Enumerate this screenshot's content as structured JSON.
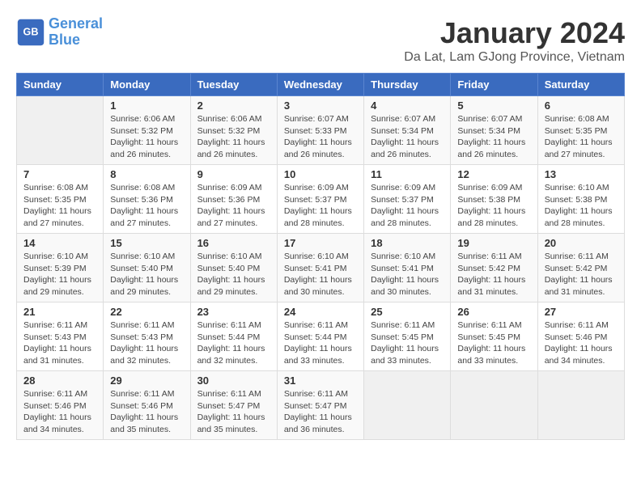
{
  "header": {
    "logo_line1": "General",
    "logo_line2": "Blue",
    "title": "January 2024",
    "subtitle": "Da Lat, Lam GJong Province, Vietnam"
  },
  "days_of_week": [
    "Sunday",
    "Monday",
    "Tuesday",
    "Wednesday",
    "Thursday",
    "Friday",
    "Saturday"
  ],
  "weeks": [
    [
      {
        "day": "",
        "info": ""
      },
      {
        "day": "1",
        "info": "Sunrise: 6:06 AM\nSunset: 5:32 PM\nDaylight: 11 hours\nand 26 minutes."
      },
      {
        "day": "2",
        "info": "Sunrise: 6:06 AM\nSunset: 5:32 PM\nDaylight: 11 hours\nand 26 minutes."
      },
      {
        "day": "3",
        "info": "Sunrise: 6:07 AM\nSunset: 5:33 PM\nDaylight: 11 hours\nand 26 minutes."
      },
      {
        "day": "4",
        "info": "Sunrise: 6:07 AM\nSunset: 5:34 PM\nDaylight: 11 hours\nand 26 minutes."
      },
      {
        "day": "5",
        "info": "Sunrise: 6:07 AM\nSunset: 5:34 PM\nDaylight: 11 hours\nand 26 minutes."
      },
      {
        "day": "6",
        "info": "Sunrise: 6:08 AM\nSunset: 5:35 PM\nDaylight: 11 hours\nand 27 minutes."
      }
    ],
    [
      {
        "day": "7",
        "info": "Sunrise: 6:08 AM\nSunset: 5:35 PM\nDaylight: 11 hours\nand 27 minutes."
      },
      {
        "day": "8",
        "info": "Sunrise: 6:08 AM\nSunset: 5:36 PM\nDaylight: 11 hours\nand 27 minutes."
      },
      {
        "day": "9",
        "info": "Sunrise: 6:09 AM\nSunset: 5:36 PM\nDaylight: 11 hours\nand 27 minutes."
      },
      {
        "day": "10",
        "info": "Sunrise: 6:09 AM\nSunset: 5:37 PM\nDaylight: 11 hours\nand 28 minutes."
      },
      {
        "day": "11",
        "info": "Sunrise: 6:09 AM\nSunset: 5:37 PM\nDaylight: 11 hours\nand 28 minutes."
      },
      {
        "day": "12",
        "info": "Sunrise: 6:09 AM\nSunset: 5:38 PM\nDaylight: 11 hours\nand 28 minutes."
      },
      {
        "day": "13",
        "info": "Sunrise: 6:10 AM\nSunset: 5:38 PM\nDaylight: 11 hours\nand 28 minutes."
      }
    ],
    [
      {
        "day": "14",
        "info": "Sunrise: 6:10 AM\nSunset: 5:39 PM\nDaylight: 11 hours\nand 29 minutes."
      },
      {
        "day": "15",
        "info": "Sunrise: 6:10 AM\nSunset: 5:40 PM\nDaylight: 11 hours\nand 29 minutes."
      },
      {
        "day": "16",
        "info": "Sunrise: 6:10 AM\nSunset: 5:40 PM\nDaylight: 11 hours\nand 29 minutes."
      },
      {
        "day": "17",
        "info": "Sunrise: 6:10 AM\nSunset: 5:41 PM\nDaylight: 11 hours\nand 30 minutes."
      },
      {
        "day": "18",
        "info": "Sunrise: 6:10 AM\nSunset: 5:41 PM\nDaylight: 11 hours\nand 30 minutes."
      },
      {
        "day": "19",
        "info": "Sunrise: 6:11 AM\nSunset: 5:42 PM\nDaylight: 11 hours\nand 31 minutes."
      },
      {
        "day": "20",
        "info": "Sunrise: 6:11 AM\nSunset: 5:42 PM\nDaylight: 11 hours\nand 31 minutes."
      }
    ],
    [
      {
        "day": "21",
        "info": "Sunrise: 6:11 AM\nSunset: 5:43 PM\nDaylight: 11 hours\nand 31 minutes."
      },
      {
        "day": "22",
        "info": "Sunrise: 6:11 AM\nSunset: 5:43 PM\nDaylight: 11 hours\nand 32 minutes."
      },
      {
        "day": "23",
        "info": "Sunrise: 6:11 AM\nSunset: 5:44 PM\nDaylight: 11 hours\nand 32 minutes."
      },
      {
        "day": "24",
        "info": "Sunrise: 6:11 AM\nSunset: 5:44 PM\nDaylight: 11 hours\nand 33 minutes."
      },
      {
        "day": "25",
        "info": "Sunrise: 6:11 AM\nSunset: 5:45 PM\nDaylight: 11 hours\nand 33 minutes."
      },
      {
        "day": "26",
        "info": "Sunrise: 6:11 AM\nSunset: 5:45 PM\nDaylight: 11 hours\nand 33 minutes."
      },
      {
        "day": "27",
        "info": "Sunrise: 6:11 AM\nSunset: 5:46 PM\nDaylight: 11 hours\nand 34 minutes."
      }
    ],
    [
      {
        "day": "28",
        "info": "Sunrise: 6:11 AM\nSunset: 5:46 PM\nDaylight: 11 hours\nand 34 minutes."
      },
      {
        "day": "29",
        "info": "Sunrise: 6:11 AM\nSunset: 5:46 PM\nDaylight: 11 hours\nand 35 minutes."
      },
      {
        "day": "30",
        "info": "Sunrise: 6:11 AM\nSunset: 5:47 PM\nDaylight: 11 hours\nand 35 minutes."
      },
      {
        "day": "31",
        "info": "Sunrise: 6:11 AM\nSunset: 5:47 PM\nDaylight: 11 hours\nand 36 minutes."
      },
      {
        "day": "",
        "info": ""
      },
      {
        "day": "",
        "info": ""
      },
      {
        "day": "",
        "info": ""
      }
    ]
  ]
}
